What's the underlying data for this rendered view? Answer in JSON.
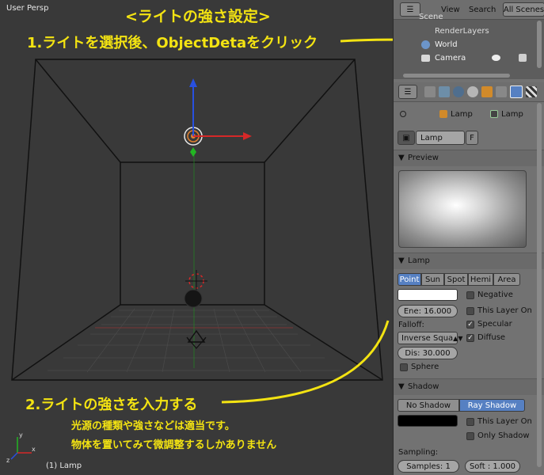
{
  "viewport": {
    "title": "User Persp",
    "footer": "(1) Lamp"
  },
  "annotations": {
    "heading": "<ライトの強さ設定>",
    "step1": "1.ライトを選択後、ObjectDetaをクリック",
    "step2": "2.ライトの強さを入力する",
    "note1": "光源の種類や強さなどは適当です。",
    "note2": "物体を置いてみて微調整するしかありません"
  },
  "outliner": {
    "view_label": "View",
    "search_label": "Search",
    "scenes_label": "All Scenes",
    "items": [
      "Scene",
      "RenderLayers",
      "World",
      "Camera"
    ]
  },
  "properties": {
    "breadcrumb": [
      "Lamp",
      "Lamp"
    ],
    "datablock_name": "Lamp",
    "fake_user": "F",
    "preview_header": "Preview",
    "lamp_header": "Lamp",
    "lamp_types": [
      "Point",
      "Sun",
      "Spot",
      "Hemi",
      "Area"
    ],
    "negative_label": "Negative",
    "energy_label": "Ene: 16.000",
    "this_layer_label": "This Layer On",
    "falloff_label": "Falloff:",
    "specular_label": "Specular",
    "falloff_value": "Inverse Squa",
    "diffuse_label": "Diffuse",
    "distance_label": "Dis: 30.000",
    "sphere_label": "Sphere",
    "shadow_header": "Shadow",
    "no_shadow_label": "No Shadow",
    "ray_shadow_label": "Ray Shadow",
    "shadow_this_layer_label": "This Layer On",
    "only_shadow_label": "Only Shadow",
    "sampling_label": "Sampling:",
    "samples_label": "Samples: 1",
    "soft_label": "Soft : 1.000"
  },
  "colors": {
    "annotation": "#f3e312",
    "accent": "#5680c2",
    "axis_x": "#d62828",
    "axis_y": "#22b622",
    "axis_z": "#2850e0"
  }
}
